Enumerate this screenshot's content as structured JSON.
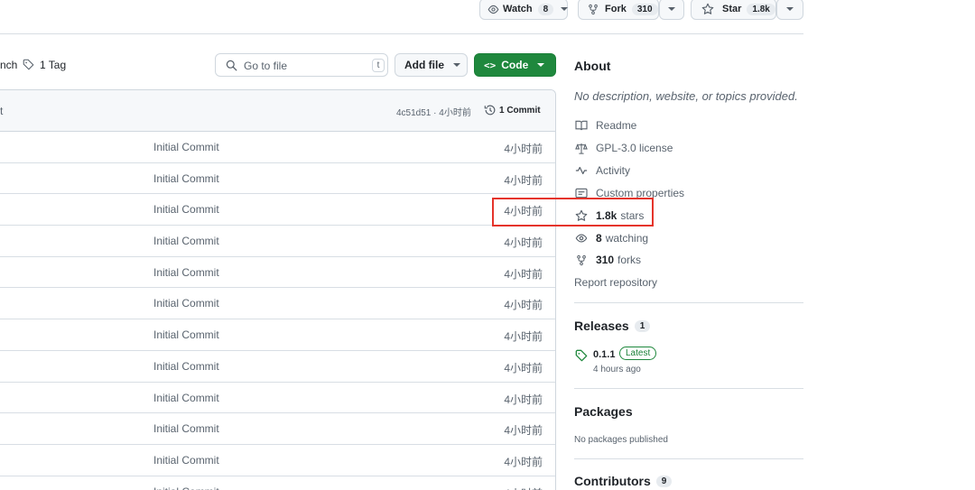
{
  "header": {
    "watch_label": "Watch",
    "watch_count": "8",
    "fork_label": "Fork",
    "fork_count": "310",
    "star_label": "Star",
    "star_count": "1.8k"
  },
  "toolbar": {
    "branch_fragment": "nch",
    "tag_label": "1 Tag",
    "search_placeholder": "Go to file",
    "search_shortcut": "t",
    "add_file_label": "Add file",
    "code_label": "Code"
  },
  "commit_bar": {
    "left_fragment": "t",
    "hash_time": "4c51d51 · 4小时前",
    "commits_label": "1 Commit"
  },
  "files": [
    {
      "message": "Initial Commit",
      "time": "4小时前"
    },
    {
      "message": "Initial Commit",
      "time": "4小时前"
    },
    {
      "message": "Initial Commit",
      "time": "4小时前"
    },
    {
      "message": "Initial Commit",
      "time": "4小时前"
    },
    {
      "message": "Initial Commit",
      "time": "4小时前"
    },
    {
      "message": "Initial Commit",
      "time": "4小时前"
    },
    {
      "message": "Initial Commit",
      "time": "4小时前"
    },
    {
      "message": "Initial Commit",
      "time": "4小时前"
    },
    {
      "message": "Initial Commit",
      "time": "4小时前"
    },
    {
      "message": "Initial Commit",
      "time": "4小时前"
    },
    {
      "message": "Initial Commit",
      "time": "4小时前"
    },
    {
      "message": "Initial Commit",
      "time": "4小时前"
    }
  ],
  "about": {
    "title": "About",
    "description": "No description, website, or topics provided.",
    "readme": "Readme",
    "license": "GPL-3.0 license",
    "activity": "Activity",
    "custom_properties": "Custom properties",
    "stars_count": "1.8k",
    "stars_label": "stars",
    "watching_count": "8",
    "watching_label": "watching",
    "forks_count": "310",
    "forks_label": "forks",
    "report": "Report repository"
  },
  "releases": {
    "title": "Releases",
    "count": "1",
    "version": "0.1.1",
    "badge": "Latest",
    "date": "4 hours ago"
  },
  "packages": {
    "title": "Packages",
    "empty": "No packages published"
  },
  "contributors": {
    "title": "Contributors",
    "count": "9"
  },
  "colors": {
    "accent_green": "#1f883d",
    "highlight_red": "#e5342b",
    "link_blue": "#0969da"
  }
}
